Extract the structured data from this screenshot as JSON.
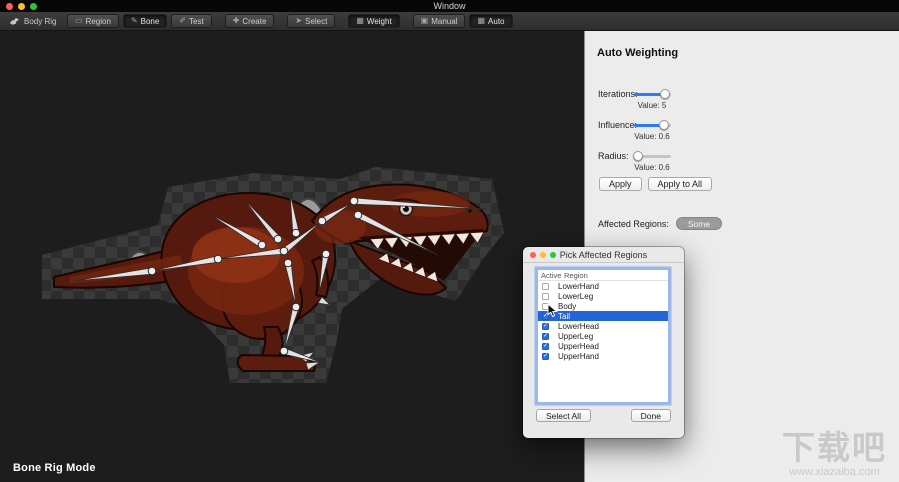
{
  "window": {
    "menu_title": "Window"
  },
  "toolbar": {
    "app_label": "Body Rig",
    "buttons": [
      {
        "label": "Region",
        "icon": "▭",
        "icon_name": "bounding-box-icon",
        "active": false,
        "group": 1
      },
      {
        "label": "Bone",
        "icon": "✎",
        "icon_name": "pencil-icon",
        "active": true,
        "group": 1
      },
      {
        "label": "Test",
        "icon": "✐",
        "icon_name": "pen-icon",
        "active": false,
        "group": 1
      },
      {
        "label": "Create",
        "icon": "✚",
        "icon_name": "plus-icon",
        "active": false,
        "group": 2
      },
      {
        "label": "Select",
        "icon": "➤",
        "icon_name": "cursor-icon",
        "active": false,
        "group": 3
      },
      {
        "label": "Weight",
        "icon": "▦",
        "icon_name": "weight-grid-icon",
        "active": true,
        "group": 4
      },
      {
        "label": "Manual",
        "icon": "▣",
        "icon_name": "manual-panel-icon",
        "active": false,
        "group": 5
      },
      {
        "label": "Auto",
        "icon": "▦",
        "icon_name": "auto-grid-icon",
        "active": true,
        "group": 5
      }
    ]
  },
  "canvas": {
    "mode_label": "Bone Rig Mode"
  },
  "panel": {
    "title": "Auto Weighting",
    "sliders": [
      {
        "label": "Iterations:",
        "value_label": "Value: 5",
        "pos": 0.85
      },
      {
        "label": "Influence:",
        "value_label": "Value: 0.6",
        "pos": 0.8
      },
      {
        "label": "Radius:",
        "value_label": "Value: 0.6",
        "pos": 0.1
      }
    ],
    "apply_label": "Apply",
    "apply_to_all_label": "Apply to All",
    "affected_regions_label": "Affected Regions:",
    "affected_regions_value": "Some"
  },
  "dialog": {
    "title": "Pick Affected Regions",
    "columns": [
      "Active",
      "Region"
    ],
    "rows": [
      {
        "region": "LowerHand",
        "checked": false,
        "selected": false
      },
      {
        "region": "LowerLeg",
        "checked": false,
        "selected": false
      },
      {
        "region": "Body",
        "checked": false,
        "selected": false
      },
      {
        "region": "Tail",
        "checked": true,
        "selected": true
      },
      {
        "region": "LowerHead",
        "checked": true,
        "selected": false
      },
      {
        "region": "UpperLeg",
        "checked": true,
        "selected": false
      },
      {
        "region": "UpperHead",
        "checked": true,
        "selected": false
      },
      {
        "region": "UpperHand",
        "checked": true,
        "selected": false
      }
    ],
    "select_all_label": "Select All",
    "done_label": "Done"
  },
  "watermark": {
    "title": "下载吧",
    "url": "www.xiazaiba.com"
  },
  "colors": {
    "accent_blue": "#2f6fe0",
    "slider_blue": "#3478f6",
    "selection_blue": "#2664d9",
    "panel_bg": "#ececec",
    "canvas_bg": "#1d1d1d",
    "toolbar_bg": "#323232"
  }
}
